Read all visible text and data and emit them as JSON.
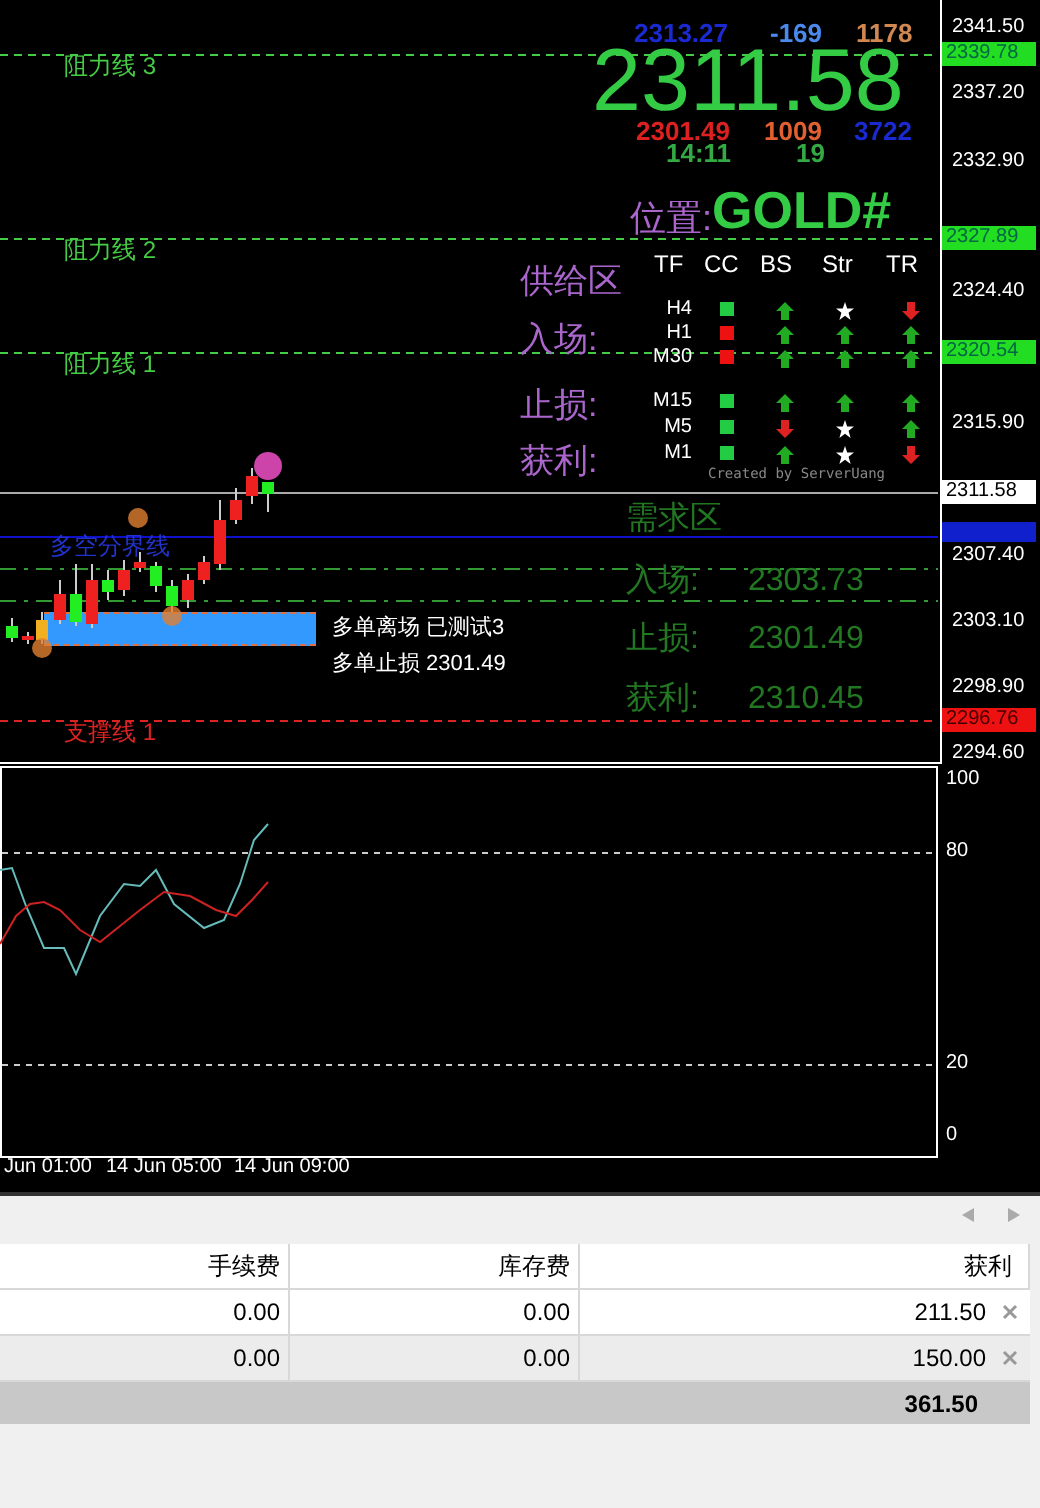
{
  "main_chart": {
    "axis_ticks": [
      "2341.50",
      "2337.20",
      "2332.90",
      "2324.40",
      "2315.90",
      "2307.40",
      "2303.10",
      "2298.90",
      "2294.60"
    ],
    "levels": [
      {
        "label": "阻力线 3",
        "price": "2339.78",
        "kind": "resistance"
      },
      {
        "label": "阻力线 2",
        "price": "2327.89",
        "kind": "resistance"
      },
      {
        "label": "阻力线 1",
        "price": "2320.54",
        "kind": "resistance"
      },
      {
        "label": "支撑线 1",
        "price": "2296.76",
        "kind": "support"
      }
    ],
    "current_price": "2311.58",
    "divider_label": "多空分界线",
    "zone": {
      "exit_label": "多单离场 已测试3",
      "stop_label": "多单止损 2301.49"
    },
    "info_panel": {
      "top_row": [
        "2313.27",
        "-169",
        "1178"
      ],
      "price": "2311.58",
      "mid_row": [
        "2301.49",
        "1009",
        "3722"
      ],
      "bottom_row": [
        "14:11",
        "19"
      ],
      "position_label": "位置:",
      "symbol": "GOLD#",
      "headers": [
        "TF",
        "CC",
        "BS",
        "Str",
        "TR"
      ],
      "rows": [
        {
          "tf": "H4",
          "color": "#22cc44",
          "signals": [
            {
              "kind": "up"
            },
            {
              "kind": "star"
            },
            {
              "kind": "down"
            }
          ]
        },
        {
          "tf": "H1",
          "color": "#ee1111",
          "signals": [
            {
              "kind": "up"
            },
            {
              "kind": "up"
            },
            {
              "kind": "up"
            }
          ]
        },
        {
          "tf": "M30",
          "color": "#ee1111",
          "signals": [
            {
              "kind": "up"
            },
            {
              "kind": "up"
            },
            {
              "kind": "up"
            }
          ]
        },
        {
          "tf": "M15",
          "color": "#22cc44",
          "signals": [
            {
              "kind": "up"
            },
            {
              "kind": "up"
            },
            {
              "kind": "up"
            }
          ]
        },
        {
          "tf": "M5",
          "color": "#22cc44",
          "signals": [
            {
              "kind": "down"
            },
            {
              "kind": "star"
            },
            {
              "kind": "up"
            }
          ]
        },
        {
          "tf": "M1",
          "color": "#22cc44",
          "signals": [
            {
              "kind": "up"
            },
            {
              "kind": "star"
            },
            {
              "kind": "down"
            }
          ]
        }
      ],
      "credit": "Created by ServerUang",
      "supply_labels": [
        "供给区",
        "入场:",
        "止损:",
        "获利:"
      ],
      "demand": {
        "title": "需求区",
        "fields": [
          {
            "label": "入场:",
            "value": "2303.73"
          },
          {
            "label": "止损:",
            "value": "2301.49"
          },
          {
            "label": "获利:",
            "value": "2310.45"
          }
        ]
      }
    }
  },
  "oscillator": {
    "ticks": [
      "100",
      "80",
      "20",
      "0"
    ]
  },
  "time_axis": [
    "Jun 01:00",
    "14 Jun 05:00",
    "14 Jun 09:00"
  ],
  "table": {
    "columns": [
      "手续费",
      "库存费",
      "获利"
    ],
    "rows": [
      {
        "cells": [
          "0.00",
          "0.00",
          "211.50"
        ]
      },
      {
        "cells": [
          "0.00",
          "0.00",
          "150.00"
        ]
      }
    ],
    "total": "361.50"
  }
}
